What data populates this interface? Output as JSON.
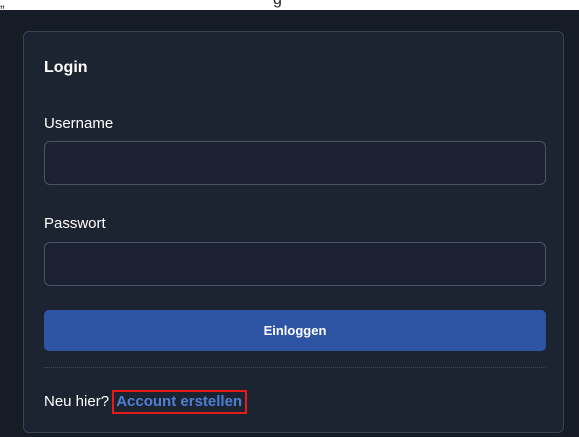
{
  "top_fragment": {
    "quote": "„",
    "glyph": "g"
  },
  "login": {
    "title": "Login",
    "username_label": "Username",
    "username_value": "",
    "password_label": "Passwort",
    "password_value": "",
    "submit_label": "Einloggen",
    "signup_prompt": "Neu hier?",
    "signup_link": "Account erstellen"
  },
  "colors": {
    "background": "#161c26",
    "card": "#1d2431",
    "button": "#2e55a3",
    "link": "#4d7fd3",
    "highlight": "#e81b1b"
  }
}
